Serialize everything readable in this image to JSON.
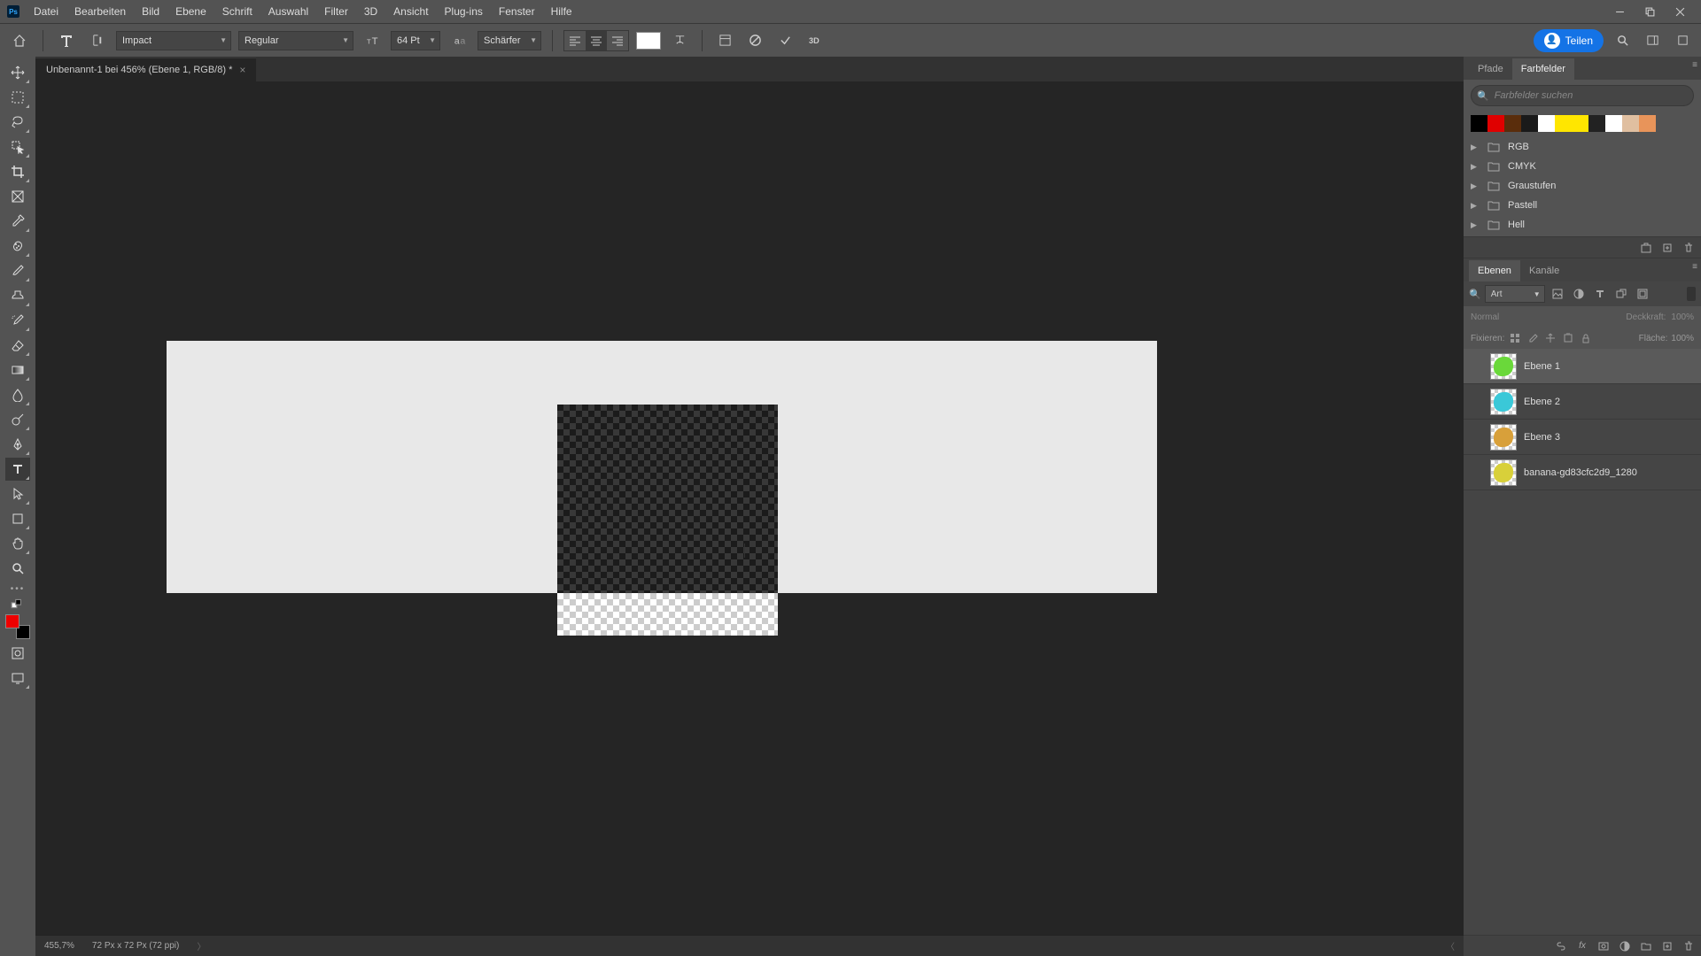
{
  "menu": [
    "Datei",
    "Bearbeiten",
    "Bild",
    "Ebene",
    "Schrift",
    "Auswahl",
    "Filter",
    "3D",
    "Ansicht",
    "Plug-ins",
    "Fenster",
    "Hilfe"
  ],
  "options": {
    "font": "Impact",
    "weight": "Regular",
    "size": "64 Pt",
    "antialias": "Schärfer",
    "share": "Teilen"
  },
  "doc_tab": "Unbenannt-1 bei 456% (Ebene 1, RGB/8) *",
  "swatches": {
    "tab_paths": "Pfade",
    "tab_swatches": "Farbfelder",
    "search_placeholder": "Farbfelder suchen",
    "colors": [
      "#000000",
      "#e00000",
      "#5a2d0c",
      "#1a1a1a",
      "#ffffff",
      "#ffe600",
      "#ffe600",
      "#222222",
      "#ffffff",
      "#e0bfa0",
      "#e8945a"
    ],
    "folders": [
      "RGB",
      "CMYK",
      "Graustufen",
      "Pastell",
      "Hell"
    ]
  },
  "layers_panel": {
    "tab_layers": "Ebenen",
    "tab_channels": "Kanäle",
    "filter_kind": "Art",
    "blend_mode": "Normal",
    "opacity_label": "Deckkraft:",
    "opacity_value": "100%",
    "lock_label": "Fixieren:",
    "fill_label": "Fläche:",
    "fill_value": "100%",
    "layers": [
      {
        "name": "Ebene 1",
        "color": "#6ad83a",
        "selected": true
      },
      {
        "name": "Ebene 2",
        "color": "#3ac8d8",
        "selected": false
      },
      {
        "name": "Ebene 3",
        "color": "#d8a03a",
        "selected": false
      },
      {
        "name": "banana-gd83cfc2d9_1280",
        "color": "#d8d03a",
        "selected": false
      }
    ]
  },
  "status": {
    "zoom": "455,7%",
    "info": "72 Px x 72 Px (72 ppi)"
  },
  "filter_search_icon": "🔍"
}
